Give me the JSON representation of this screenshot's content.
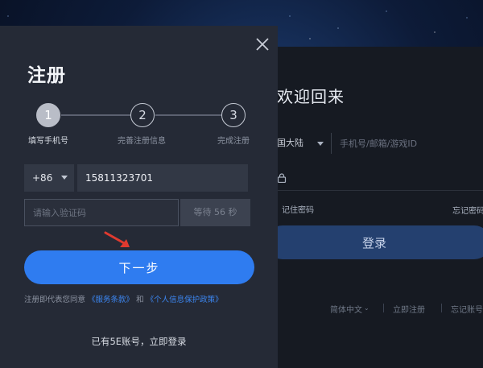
{
  "background_panel": {
    "title": "欢迎回来",
    "region": "国大陆",
    "phone_placeholder": "手机号/邮箱/游戏ID",
    "remember": "记住密码",
    "forgot": "忘记密码",
    "login_label": "登录",
    "footer": [
      "简体中文",
      "立即注册",
      "忘记账号"
    ]
  },
  "modal": {
    "title": "注册",
    "steps": [
      {
        "number": "1",
        "label": "填写手机号",
        "active": true
      },
      {
        "number": "2",
        "label": "完善注册信息",
        "active": false
      },
      {
        "number": "3",
        "label": "完成注册",
        "active": false
      }
    ],
    "country_code": "+86",
    "phone_value": "15811323701",
    "code_placeholder": "请输入验证码",
    "code_button": "等待 56 秒",
    "next_label": "下一步",
    "terms": {
      "prefix": "注册即代表您同意",
      "service_link": "《服务条款》",
      "and": "和",
      "privacy_link": "《个人信息保护政策》"
    },
    "already_account": "已有5E账号，立即登录"
  },
  "colors": {
    "primary_button": "#2f7cf0",
    "link": "#3c87f2",
    "modal_bg": "#252a36",
    "field_bg": "#323845"
  },
  "icons": [
    "close-icon",
    "chevron-down-icon",
    "lock-icon",
    "red-arrow-pointer"
  ]
}
